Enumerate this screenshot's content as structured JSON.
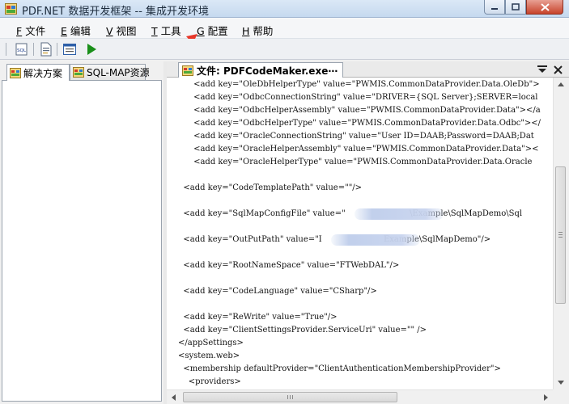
{
  "window": {
    "title": "PDF.NET 数据开发框架 -- 集成开发环境",
    "app_icon": "app-window-icon"
  },
  "menu": [
    {
      "key": "F",
      "label": "文件"
    },
    {
      "key": "E",
      "label": "编辑"
    },
    {
      "key": "V",
      "label": "视图"
    },
    {
      "key": "T",
      "label": "工具"
    },
    {
      "key": "G",
      "label": "配置"
    },
    {
      "key": "H",
      "label": "帮助"
    }
  ],
  "toolbar": {
    "sql_label": "SQL",
    "icons": [
      "sql-icon",
      "document-icon",
      "list-icon",
      "run-icon"
    ]
  },
  "left_tabs": [
    {
      "label": "解决方案",
      "active": true
    },
    {
      "label": "SQL-MAP资源",
      "active": false
    }
  ],
  "document": {
    "tab_label": "文件: PDFCodeMaker.exe⋯"
  },
  "code_lines": [
    "      <add key=\"OleDbHelperType\" value=\"PWMIS.CommonDataProvider.Data.OleDb\">",
    "      <add key=\"OdbcConnectionString\" value=\"DRIVER={SQL Server};SERVER=local",
    "      <add key=\"OdbcHelperAssembly\" value=\"PWMIS.CommonDataProvider.Data\"></a",
    "      <add key=\"OdbcHelperType\" value=\"PWMIS.CommonDataProvider.Data.Odbc\"></",
    "      <add key=\"OracleConnectionString\" value=\"User ID=DAAB;Password=DAAB;Dat",
    "      <add key=\"OracleHelperAssembly\" value=\"PWMIS.CommonDataProvider.Data\"><",
    "      <add key=\"OracleHelperType\" value=\"PWMIS.CommonDataProvider.Data.Oracle",
    "",
    "  <add key=\"CodeTemplatePath\" value=\"\"/>",
    "",
    "  <add key=\"SqlMapConfigFile\" value=\"                         \\Example\\SqlMapDemo\\Sql",
    "",
    "  <add key=\"OutPutPath\" value=\"I                        Example\\SqlMapDemo\"/>",
    "",
    "  <add key=\"RootNameSpace\" value=\"FTWebDAL\"/>",
    "",
    "  <add key=\"CodeLanguage\" value=\"CSharp\"/>",
    "",
    "  <add key=\"ReWrite\" value=\"True\"/>",
    "  <add key=\"ClientSettingsProvider.ServiceUri\" value=\"\" />",
    "</appSettings>",
    "<system.web>",
    "  <membership defaultProvider=\"ClientAuthenticationMembershipProvider\">",
    "    <providers>"
  ],
  "colors": {
    "annotation_arrow": "#e8382a",
    "run_icon": "#1a8f1a"
  }
}
